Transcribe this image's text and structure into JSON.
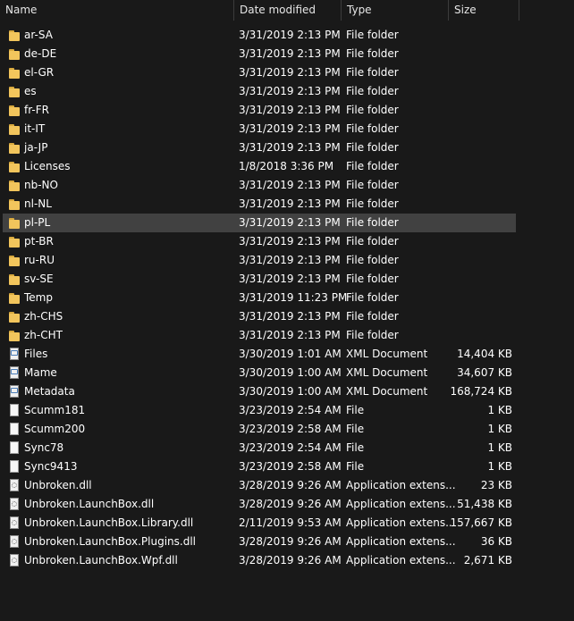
{
  "columns": {
    "name": "Name",
    "date": "Date modified",
    "type": "Type",
    "size": "Size"
  },
  "rows": [
    {
      "name": "ar-SA",
      "date": "3/31/2019 2:13 PM",
      "type": "File folder",
      "size": "",
      "icon": "folder-icon"
    },
    {
      "name": "de-DE",
      "date": "3/31/2019 2:13 PM",
      "type": "File folder",
      "size": "",
      "icon": "folder-icon"
    },
    {
      "name": "el-GR",
      "date": "3/31/2019 2:13 PM",
      "type": "File folder",
      "size": "",
      "icon": "folder-icon"
    },
    {
      "name": "es",
      "date": "3/31/2019 2:13 PM",
      "type": "File folder",
      "size": "",
      "icon": "folder-icon"
    },
    {
      "name": "fr-FR",
      "date": "3/31/2019 2:13 PM",
      "type": "File folder",
      "size": "",
      "icon": "folder-icon"
    },
    {
      "name": "it-IT",
      "date": "3/31/2019 2:13 PM",
      "type": "File folder",
      "size": "",
      "icon": "folder-icon"
    },
    {
      "name": "ja-JP",
      "date": "3/31/2019 2:13 PM",
      "type": "File folder",
      "size": "",
      "icon": "folder-icon"
    },
    {
      "name": "Licenses",
      "date": "1/8/2018 3:36 PM",
      "type": "File folder",
      "size": "",
      "icon": "folder-icon"
    },
    {
      "name": "nb-NO",
      "date": "3/31/2019 2:13 PM",
      "type": "File folder",
      "size": "",
      "icon": "folder-icon"
    },
    {
      "name": "nl-NL",
      "date": "3/31/2019 2:13 PM",
      "type": "File folder",
      "size": "",
      "icon": "folder-icon"
    },
    {
      "name": "pl-PL",
      "date": "3/31/2019 2:13 PM",
      "type": "File folder",
      "size": "",
      "icon": "folder-icon",
      "selected": true
    },
    {
      "name": "pt-BR",
      "date": "3/31/2019 2:13 PM",
      "type": "File folder",
      "size": "",
      "icon": "folder-icon"
    },
    {
      "name": "ru-RU",
      "date": "3/31/2019 2:13 PM",
      "type": "File folder",
      "size": "",
      "icon": "folder-icon"
    },
    {
      "name": "sv-SE",
      "date": "3/31/2019 2:13 PM",
      "type": "File folder",
      "size": "",
      "icon": "folder-icon"
    },
    {
      "name": "Temp",
      "date": "3/31/2019 11:23 PM",
      "type": "File folder",
      "size": "",
      "icon": "folder-icon"
    },
    {
      "name": "zh-CHS",
      "date": "3/31/2019 2:13 PM",
      "type": "File folder",
      "size": "",
      "icon": "folder-icon"
    },
    {
      "name": "zh-CHT",
      "date": "3/31/2019 2:13 PM",
      "type": "File folder",
      "size": "",
      "icon": "folder-icon"
    },
    {
      "name": "Files",
      "date": "3/30/2019 1:01 AM",
      "type": "XML Document",
      "size": "14,404 KB",
      "icon": "xml-document-icon"
    },
    {
      "name": "Mame",
      "date": "3/30/2019 1:00 AM",
      "type": "XML Document",
      "size": "34,607 KB",
      "icon": "xml-document-icon"
    },
    {
      "name": "Metadata",
      "date": "3/30/2019 1:00 AM",
      "type": "XML Document",
      "size": "168,724 KB",
      "icon": "xml-document-icon"
    },
    {
      "name": "Scumm181",
      "date": "3/23/2019 2:54 AM",
      "type": "File",
      "size": "1 KB",
      "icon": "file-icon"
    },
    {
      "name": "Scumm200",
      "date": "3/23/2019 2:58 AM",
      "type": "File",
      "size": "1 KB",
      "icon": "file-icon"
    },
    {
      "name": "Sync78",
      "date": "3/23/2019 2:54 AM",
      "type": "File",
      "size": "1 KB",
      "icon": "file-icon"
    },
    {
      "name": "Sync9413",
      "date": "3/23/2019 2:58 AM",
      "type": "File",
      "size": "1 KB",
      "icon": "file-icon"
    },
    {
      "name": "Unbroken.dll",
      "date": "3/28/2019 9:26 AM",
      "type": "Application extens...",
      "size": "23 KB",
      "icon": "dll-icon"
    },
    {
      "name": "Unbroken.LaunchBox.dll",
      "date": "3/28/2019 9:26 AM",
      "type": "Application extens...",
      "size": "51,438 KB",
      "icon": "dll-icon"
    },
    {
      "name": "Unbroken.LaunchBox.Library.dll",
      "date": "2/11/2019 9:53 AM",
      "type": "Application extens...",
      "size": "157,667 KB",
      "icon": "dll-icon"
    },
    {
      "name": "Unbroken.LaunchBox.Plugins.dll",
      "date": "3/28/2019 9:26 AM",
      "type": "Application extens...",
      "size": "36 KB",
      "icon": "dll-icon"
    },
    {
      "name": "Unbroken.LaunchBox.Wpf.dll",
      "date": "3/28/2019 9:26 AM",
      "type": "Application extens...",
      "size": "2,671 KB",
      "icon": "dll-icon"
    }
  ]
}
